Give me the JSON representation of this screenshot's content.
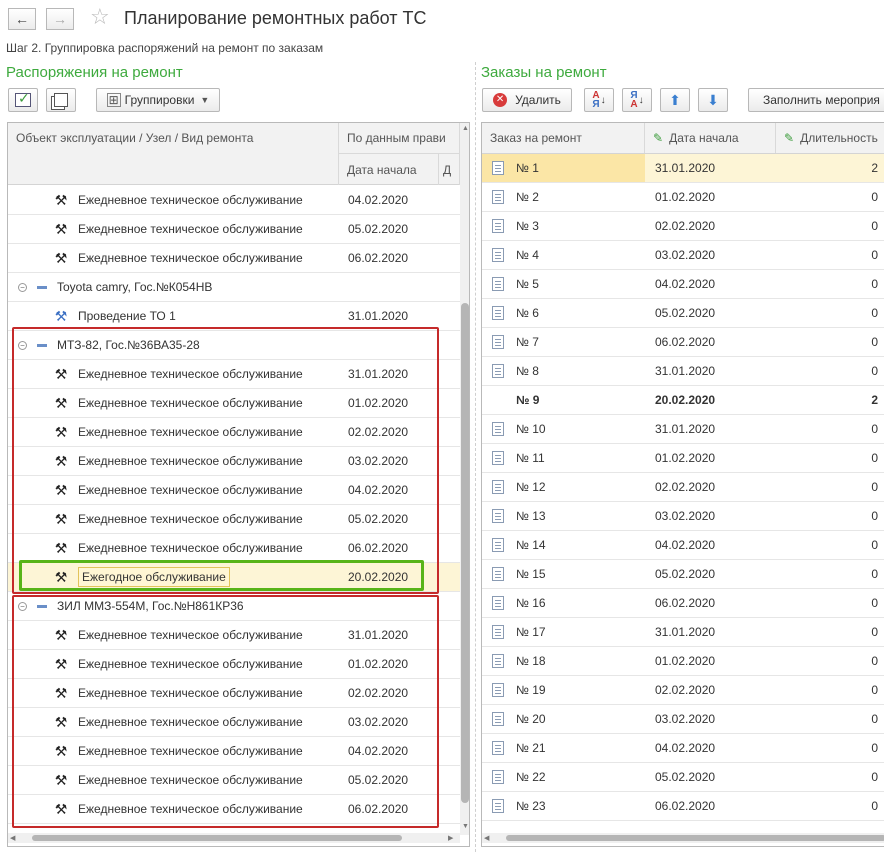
{
  "window": {
    "title": "Планирование ремонтных работ ТС",
    "step": "Шаг 2. Группировка распоряжений на ремонт по заказам"
  },
  "nav": {
    "back": "←",
    "forward": "→"
  },
  "left": {
    "section_title": "Распоряжения на ремонт",
    "toolbar": {
      "groupings_label": "Группировки"
    },
    "columns": {
      "object": "Объект эксплуатации / Узел / Вид ремонта",
      "rule_group": "По данным прави",
      "start_date": "Дата начала",
      "extra": "Д"
    },
    "rows": [
      {
        "kind": "item",
        "text": "Ежедневное техническое обслуживание",
        "date": "04.02.2020"
      },
      {
        "kind": "item",
        "text": "Ежедневное техническое обслуживание",
        "date": "05.02.2020"
      },
      {
        "kind": "item",
        "text": "Ежедневное техническое обслуживание",
        "date": "06.02.2020"
      },
      {
        "kind": "group",
        "text": "Toyota camry, Гос.№К054НВ",
        "date": ""
      },
      {
        "kind": "item2",
        "text": "Проведение ТО 1",
        "date": "31.01.2020"
      },
      {
        "kind": "group",
        "text": "МТЗ-82, Гос.№36ВА35-28",
        "date": ""
      },
      {
        "kind": "item",
        "text": "Ежедневное техническое обслуживание",
        "date": "31.01.2020"
      },
      {
        "kind": "item",
        "text": "Ежедневное техническое обслуживание",
        "date": "01.02.2020"
      },
      {
        "kind": "item",
        "text": "Ежедневное техническое обслуживание",
        "date": "02.02.2020"
      },
      {
        "kind": "item",
        "text": "Ежедневное техническое обслуживание",
        "date": "03.02.2020"
      },
      {
        "kind": "item",
        "text": "Ежедневное техническое обслуживание",
        "date": "04.02.2020"
      },
      {
        "kind": "item",
        "text": "Ежедневное техническое обслуживание",
        "date": "05.02.2020"
      },
      {
        "kind": "item",
        "text": "Ежедневное техническое обслуживание",
        "date": "06.02.2020"
      },
      {
        "kind": "selected",
        "text": "Ежегодное обслуживание",
        "date": "20.02.2020"
      },
      {
        "kind": "group",
        "text": "ЗИЛ ММЗ-554М, Гос.№Н861КР36",
        "date": ""
      },
      {
        "kind": "item",
        "text": "Ежедневное техническое обслуживание",
        "date": "31.01.2020"
      },
      {
        "kind": "item",
        "text": "Ежедневное техническое обслуживание",
        "date": "01.02.2020"
      },
      {
        "kind": "item",
        "text": "Ежедневное техническое обслуживание",
        "date": "02.02.2020"
      },
      {
        "kind": "item",
        "text": "Ежедневное техническое обслуживание",
        "date": "03.02.2020"
      },
      {
        "kind": "item",
        "text": "Ежедневное техническое обслуживание",
        "date": "04.02.2020"
      },
      {
        "kind": "item",
        "text": "Ежедневное техническое обслуживание",
        "date": "05.02.2020"
      },
      {
        "kind": "item",
        "text": "Ежедневное техническое обслуживание",
        "date": "06.02.2020"
      }
    ]
  },
  "right": {
    "section_title": "Заказы на ремонт",
    "toolbar": {
      "delete_label": "Удалить",
      "fill_label": "Заполнить мероприя"
    },
    "columns": {
      "order": "Заказ на ремонт",
      "start_date": "Дата начала",
      "duration": "Длительность"
    },
    "rows": [
      {
        "num": "№ 1",
        "date": "31.01.2020",
        "dur": "2",
        "hl": true
      },
      {
        "num": "№ 2",
        "date": "01.02.2020",
        "dur": "0"
      },
      {
        "num": "№ 3",
        "date": "02.02.2020",
        "dur": "0"
      },
      {
        "num": "№ 4",
        "date": "03.02.2020",
        "dur": "0"
      },
      {
        "num": "№ 5",
        "date": "04.02.2020",
        "dur": "0"
      },
      {
        "num": "№ 6",
        "date": "05.02.2020",
        "dur": "0"
      },
      {
        "num": "№ 7",
        "date": "06.02.2020",
        "dur": "0"
      },
      {
        "num": "№ 8",
        "date": "31.01.2020",
        "dur": "0"
      },
      {
        "num": "№ 9",
        "date": "20.02.2020",
        "dur": "2",
        "bold": true
      },
      {
        "num": "№ 10",
        "date": "31.01.2020",
        "dur": "0"
      },
      {
        "num": "№ 11",
        "date": "01.02.2020",
        "dur": "0"
      },
      {
        "num": "№ 12",
        "date": "02.02.2020",
        "dur": "0"
      },
      {
        "num": "№ 13",
        "date": "03.02.2020",
        "dur": "0"
      },
      {
        "num": "№ 14",
        "date": "04.02.2020",
        "dur": "0"
      },
      {
        "num": "№ 15",
        "date": "05.02.2020",
        "dur": "0"
      },
      {
        "num": "№ 16",
        "date": "06.02.2020",
        "dur": "0"
      },
      {
        "num": "№ 17",
        "date": "31.01.2020",
        "dur": "0"
      },
      {
        "num": "№ 18",
        "date": "01.02.2020",
        "dur": "0"
      },
      {
        "num": "№ 19",
        "date": "02.02.2020",
        "dur": "0"
      },
      {
        "num": "№ 20",
        "date": "03.02.2020",
        "dur": "0"
      },
      {
        "num": "№ 21",
        "date": "04.02.2020",
        "dur": "0"
      },
      {
        "num": "№ 22",
        "date": "05.02.2020",
        "dur": "0"
      },
      {
        "num": "№ 23",
        "date": "06.02.2020",
        "dur": "0"
      }
    ]
  },
  "colors": {
    "section_green": "#3eaa3e",
    "highlight": "#fdf5d6",
    "red_frame": "#c52a2a",
    "green_frame": "#58b418"
  }
}
